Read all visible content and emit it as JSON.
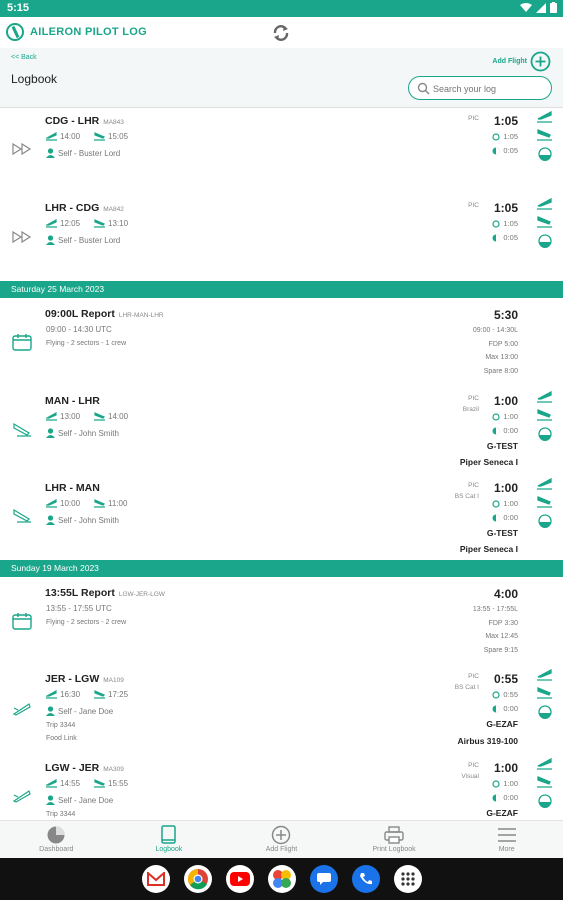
{
  "status_bar": {
    "time": "5:15"
  },
  "header": {
    "app_title": "AILERON PILOT LOG"
  },
  "subbar": {
    "back_label": "<< Back",
    "page_title": "Logbook",
    "add_flight_label": "Add Flight",
    "search_placeholder": "Search your log"
  },
  "rows_top": [
    {
      "route": "CDG - LHR",
      "flight_no": "MA843",
      "dep": "14:00",
      "arr": "15:05",
      "crew": "Self - Buster Lord",
      "role": "PIC",
      "block": "1:05",
      "mini1": "1:05",
      "mini2": "0:05"
    },
    {
      "route": "LHR - CDG",
      "flight_no": "MA842",
      "dep": "12:05",
      "arr": "13:10",
      "crew": "Self - Buster Lord",
      "role": "PIC",
      "block": "1:05",
      "mini1": "1:05",
      "mini2": "0:05"
    }
  ],
  "sections": [
    {
      "header": "Saturday 25 March 2023",
      "duty": {
        "title": "09:00L Report",
        "tag": "LHR-MAN-LHR",
        "hours": "09:00 - 14:30 UTC",
        "desc": "Flying - 2 sectors - 1 crew",
        "block": "5:30",
        "r1": "09:00 - 14:30L",
        "r2": "FDP 5:00",
        "r3": "Max 13:00",
        "r4": "Spare 8:00"
      },
      "flights": [
        {
          "route": "MAN - LHR",
          "flight_no": "",
          "dep": "13:00",
          "arr": "14:00",
          "crew": "Self - John Smith",
          "role": "PIC",
          "role2": "Brazil",
          "block": "1:00",
          "mini1": "1:00",
          "mini2": "0:00",
          "reg": "G-TEST",
          "actype": "Piper Seneca I"
        },
        {
          "route": "LHR - MAN",
          "flight_no": "",
          "dep": "10:00",
          "arr": "11:00",
          "crew": "Self - John Smith",
          "role": "PIC",
          "role2": "BS Cat I",
          "block": "1:00",
          "mini1": "1:00",
          "mini2": "0:00",
          "reg": "G-TEST",
          "actype": "Piper Seneca I"
        }
      ]
    },
    {
      "header": "Sunday 19 March 2023",
      "duty": {
        "title": "13:55L Report",
        "tag": "LGW-JER-LGW",
        "hours": "13:55 - 17:55 UTC",
        "desc": "Flying - 2 sectors - 2 crew",
        "block": "4:00",
        "r1": "13:55 - 17:55L",
        "r2": "FDP 3:30",
        "r3": "Max 12:45",
        "r4": "Spare 9:15"
      },
      "flights": [
        {
          "route": "JER - LGW",
          "flight_no": "MA109",
          "dep": "16:30",
          "arr": "17:25",
          "crew": "Self - Jane Doe",
          "trip": "Trip 3344",
          "extra": "Food Link",
          "role": "PIC",
          "role2": "BS Cat I",
          "block": "0:55",
          "mini1": "0:55",
          "mini2": "0:00",
          "reg": "G-EZAF",
          "actype": "Airbus 319-100"
        },
        {
          "route": "LGW - JER",
          "flight_no": "MA309",
          "dep": "14:55",
          "arr": "15:55",
          "crew": "Self - Jane Doe",
          "trip": "Trip 3344",
          "role": "PIC",
          "role2": "Visual",
          "block": "1:00",
          "mini1": "1:00",
          "mini2": "0:00",
          "reg": "G-EZAF"
        }
      ]
    }
  ],
  "bottom_nav": [
    {
      "label": "Dashboard",
      "icon": "pie-chart-icon"
    },
    {
      "label": "Logbook",
      "icon": "book-icon"
    },
    {
      "label": "Add Flight",
      "icon": "plus-circle-icon"
    },
    {
      "label": "Print Logbook",
      "icon": "printer-icon"
    },
    {
      "label": "More",
      "icon": "menu-icon"
    }
  ],
  "colors": {
    "accent": "#1aa68a",
    "text": "#222222",
    "muted": "#777777"
  }
}
